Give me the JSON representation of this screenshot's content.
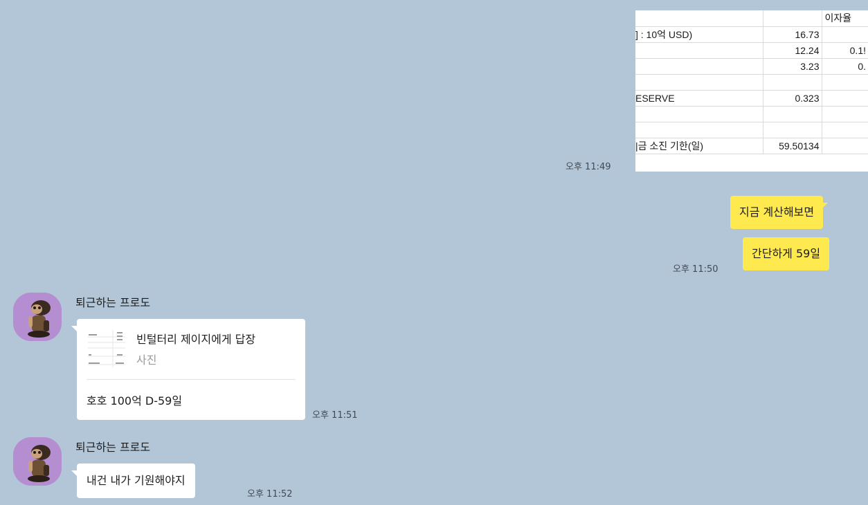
{
  "colors": {
    "background": "#b3c6d7",
    "my_bubble": "#fee94e",
    "friend_bubble": "#ffffff",
    "avatar_bg": "#b58ed1"
  },
  "messages": {
    "m1": {
      "type": "image-spreadsheet",
      "time": "오후 11:49",
      "sheet": {
        "header": [
          "",
          "",
          "이자율"
        ],
        "rows": [
          [
            "] : 10억 USD)",
            "16.73",
            ""
          ],
          [
            "",
            "12.24",
            "0.1!"
          ],
          [
            "",
            "3.23",
            "0."
          ],
          [
            "",
            "",
            ""
          ],
          [
            "ESERVE",
            "0.323",
            ""
          ],
          [
            "",
            "",
            ""
          ],
          [
            "",
            "",
            ""
          ],
          [
            "|금 소진 기한(일)",
            "59.50134",
            ""
          ]
        ]
      }
    },
    "m2": {
      "text": "지금 계산해보면"
    },
    "m3": {
      "text": "간단하게 59일",
      "time": "오후 11:50"
    },
    "m4": {
      "sender": "퇴근하는 프로도",
      "avatar_icon": "frodo-character-icon",
      "reply_title": "빈털터리 제이지에게 답장",
      "reply_subtitle": "사진",
      "text": "호호 100억 D-59일",
      "time": "오후 11:51"
    },
    "m5": {
      "sender": "퇴근하는 프로도",
      "avatar_icon": "frodo-character-icon",
      "text": "내건 내가 기원해야지",
      "time": "오후 11:52"
    }
  }
}
